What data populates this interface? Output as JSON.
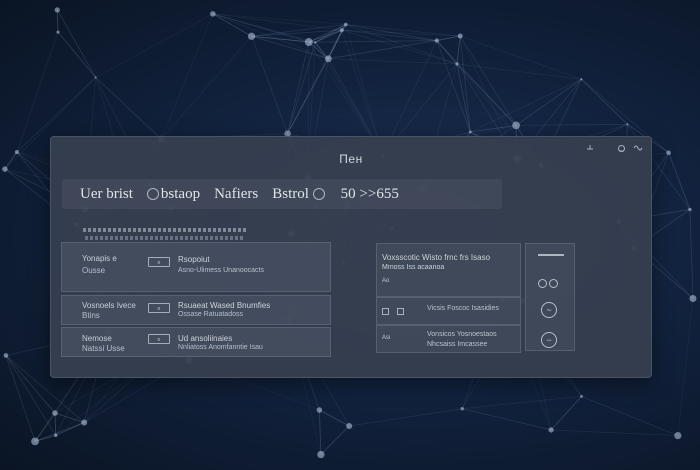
{
  "window": {
    "title": "Пен"
  },
  "tabs": [
    {
      "label": "Uer brist"
    },
    {
      "label": "bstaop"
    },
    {
      "label": "Nafiers"
    },
    {
      "label": "Bstrol"
    },
    {
      "label": "50 >>655"
    }
  ],
  "left_rows": [
    {
      "label": "Yonapis e",
      "sublabel": "Ousse",
      "chip": "≡",
      "value": "Rsopoiut",
      "detail": "Asno-Ulimess Unanoocacts"
    },
    {
      "label": "Vosnoels Ivece",
      "sublabel": "Btins",
      "chip": "≡",
      "value": "Rsuaeat Wased Bnumfies",
      "detail": "Ossase Ratuatadoss"
    },
    {
      "label": "Nemose",
      "sublabel": "Natssi Usse",
      "chip": "≡",
      "value": "Ud ansoliinaies",
      "detail": "Nnliatoss Anomfanntie Isau"
    }
  ],
  "right_rows": [
    {
      "label": "Voxsscotic Wisto frnc frs Isaso",
      "detail": "Mmoss Iss acaanoa"
    },
    {
      "label": "Vicsis Foscoc Isasidies",
      "detail": ""
    },
    {
      "label": "Vonsicos Yosnoestaos",
      "detail": "Nhcsaiss Imcassee"
    }
  ],
  "right_rows_mini": [
    "Ao",
    "Asi"
  ],
  "actions": {
    "circle_1": "○○",
    "circle_2": "~",
    "circle_3": "−"
  }
}
